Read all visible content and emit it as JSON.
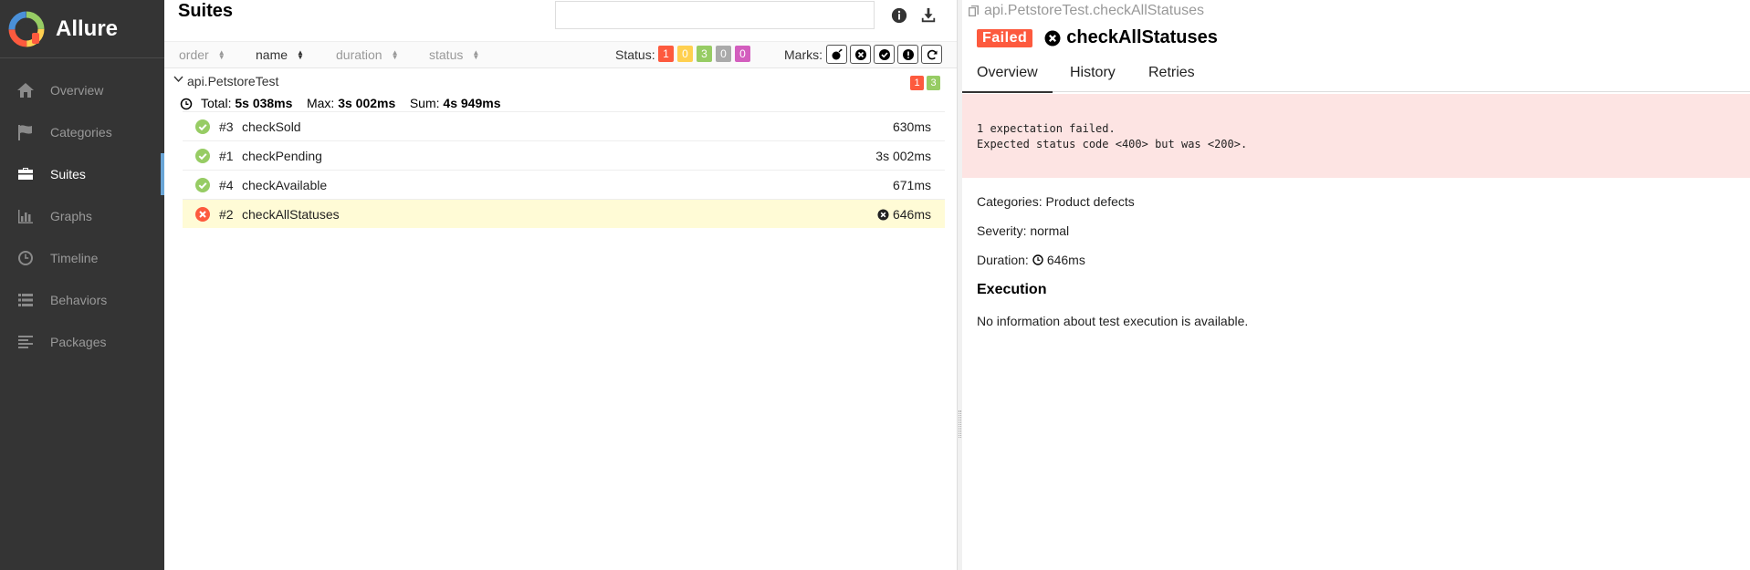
{
  "brand": {
    "name": "Allure",
    "logo_icon": "allure-logo-icon"
  },
  "sidebar": {
    "items": [
      {
        "label": "Overview",
        "icon": "home-icon",
        "active": false
      },
      {
        "label": "Categories",
        "icon": "flag-icon",
        "active": false
      },
      {
        "label": "Suites",
        "icon": "briefcase-icon",
        "active": true
      },
      {
        "label": "Graphs",
        "icon": "bar-chart-icon",
        "active": false
      },
      {
        "label": "Timeline",
        "icon": "clock-icon",
        "active": false
      },
      {
        "label": "Behaviors",
        "icon": "list-icon",
        "active": false
      },
      {
        "label": "Packages",
        "icon": "align-left-icon",
        "active": false
      }
    ]
  },
  "suites_pane": {
    "title": "Suites",
    "search_value": "",
    "sort": {
      "order": "order",
      "name": "name",
      "duration": "duration",
      "status": "status"
    },
    "status_label": "Status:",
    "status_counts": [
      {
        "name": "failed",
        "count": "1",
        "color": "#fd5a3e"
      },
      {
        "name": "broken",
        "count": "0",
        "color": "#ffd050"
      },
      {
        "name": "passed",
        "count": "3",
        "color": "#97cc64"
      },
      {
        "name": "skipped",
        "count": "0",
        "color": "#aaaaaa"
      },
      {
        "name": "unknown",
        "count": "0",
        "color": "#d35ebe"
      }
    ],
    "marks_label": "Marks:",
    "group": {
      "name": "api.PetstoreTest",
      "failed_count": "1",
      "passed_count": "3",
      "total_label": "Total:",
      "total": "5s 038ms",
      "max_label": "Max:",
      "max": "3s 002ms",
      "sum_label": "Sum:",
      "sum": "4s 949ms"
    },
    "tests": [
      {
        "num": "#3",
        "name": "checkSold",
        "duration": "630ms",
        "status": "passed"
      },
      {
        "num": "#1",
        "name": "checkPending",
        "duration": "3s 002ms",
        "status": "passed"
      },
      {
        "num": "#4",
        "name": "checkAvailable",
        "duration": "671ms",
        "status": "passed"
      },
      {
        "num": "#2",
        "name": "checkAllStatuses",
        "duration": "646ms",
        "status": "failed"
      }
    ]
  },
  "detail": {
    "path": "api.PetstoreTest.checkAllStatuses",
    "status_label": "Failed",
    "title": "checkAllStatuses",
    "tabs": [
      "Overview",
      "History",
      "Retries"
    ],
    "error_line1": "1 expectation failed.",
    "error_line2": "Expected status code <400> but was <200>.",
    "categories": "Categories: Product defects",
    "severity": "Severity: normal",
    "duration_label": "Duration:",
    "duration_value": "646ms",
    "execution_title": "Execution",
    "execution_note": "No information about test execution is available."
  },
  "colors": {
    "sidebar_bg": "#343434",
    "failed": "#fd5a3e",
    "passed": "#97cc64",
    "error_bg": "#fde4e3",
    "selected_row": "#fffbd6"
  }
}
